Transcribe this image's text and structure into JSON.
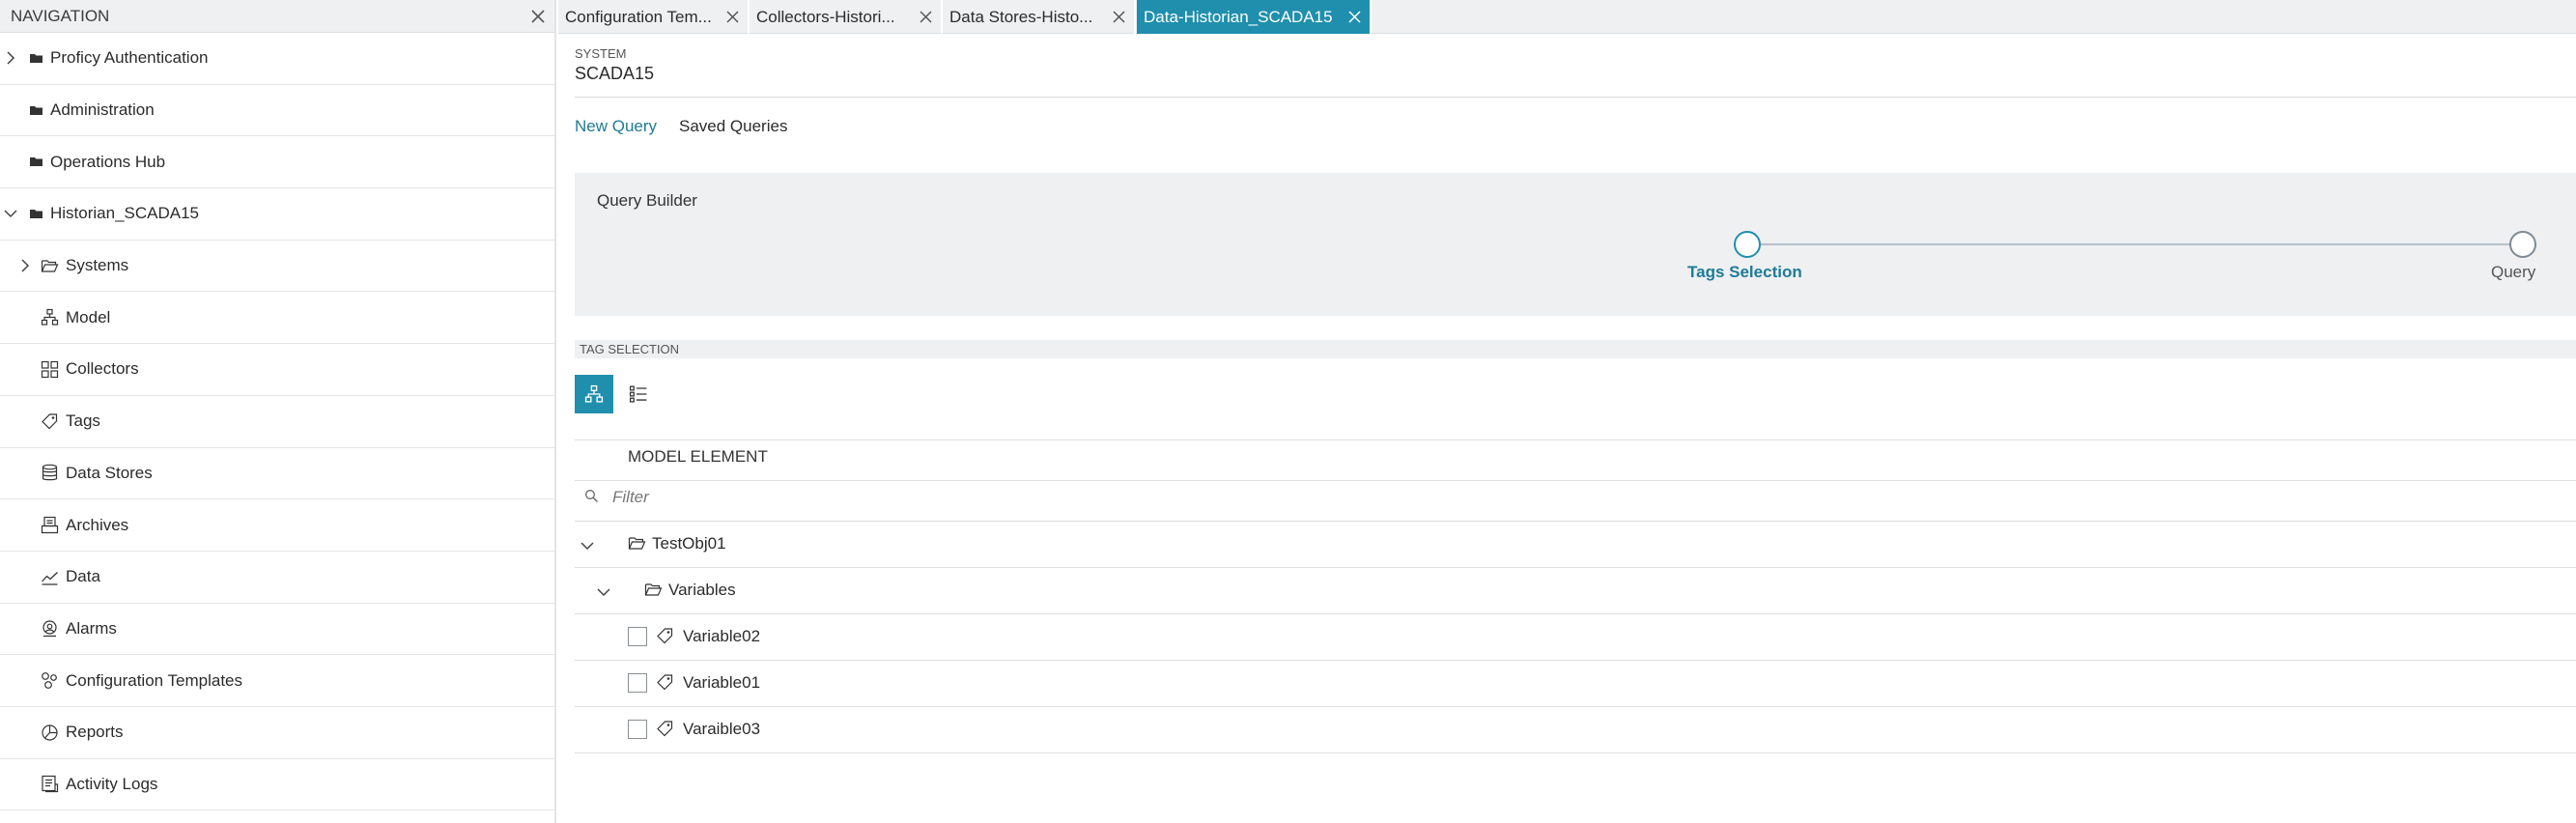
{
  "nav": {
    "title": "NAVIGATION",
    "items": [
      {
        "label": "Proficy Authentication"
      },
      {
        "label": "Administration"
      },
      {
        "label": "Operations Hub"
      },
      {
        "label": "Historian_SCADA15"
      },
      {
        "label": "Systems"
      },
      {
        "label": "Model"
      },
      {
        "label": "Collectors"
      },
      {
        "label": "Tags"
      },
      {
        "label": "Data Stores"
      },
      {
        "label": "Archives"
      },
      {
        "label": "Data"
      },
      {
        "label": "Alarms"
      },
      {
        "label": "Configuration Templates"
      },
      {
        "label": "Reports"
      },
      {
        "label": "Activity Logs"
      }
    ]
  },
  "tabs": [
    {
      "label": "Configuration Tem..."
    },
    {
      "label": "Collectors-Histori..."
    },
    {
      "label": "Data Stores-Histo..."
    },
    {
      "label": "Data-Historian_SCADA15"
    }
  ],
  "system": {
    "label": "SYSTEM",
    "value": "SCADA15"
  },
  "query_tabs": [
    {
      "label": "New Query"
    },
    {
      "label": "Saved Queries"
    }
  ],
  "query_builder": {
    "title": "Query Builder",
    "steps": [
      {
        "label": "Tags Selection"
      },
      {
        "label": "Query"
      }
    ]
  },
  "tag_selection": {
    "title": "TAG SELECTION",
    "column_header": "MODEL ELEMENT",
    "filter_placeholder": "Filter",
    "tree": {
      "root": "TestObj01",
      "group": "Variables",
      "leaves": [
        "Variable02",
        "Variable01",
        "Varaible03"
      ]
    }
  },
  "colors": {
    "accent": "#1f8fad",
    "panel_bg": "#eef0f2"
  }
}
